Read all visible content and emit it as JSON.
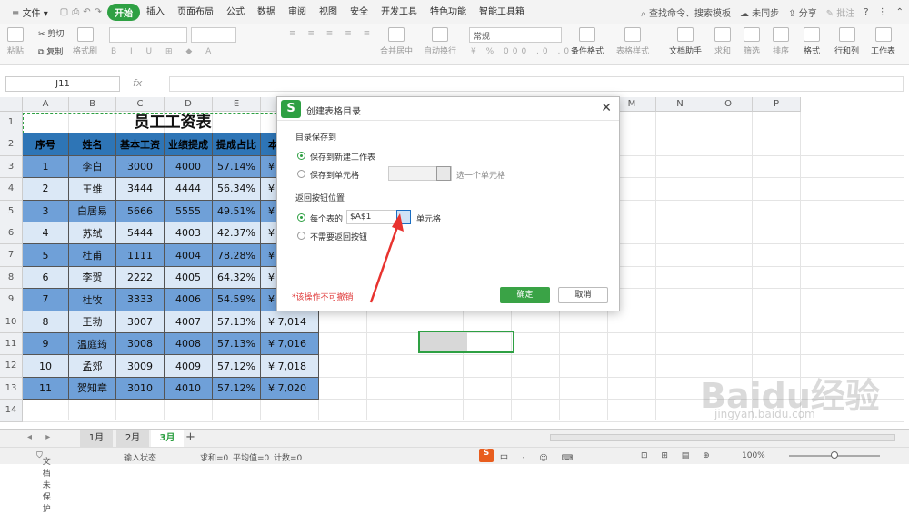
{
  "menu": {
    "file": "文件",
    "items": [
      "开始",
      "插入",
      "页面布局",
      "公式",
      "数据",
      "审阅",
      "视图",
      "安全",
      "开发工具",
      "特色功能",
      "智能工具箱"
    ],
    "active_index": 0,
    "search": "查找命令、搜索模板",
    "sync": "未同步",
    "share": "分享",
    "comment": "批注"
  },
  "ribbon": {
    "paste": "粘贴",
    "cut": "剪切",
    "copy": "复制",
    "format_painter": "格式刷",
    "merge": "合并居中",
    "wrap": "自动换行",
    "number_format": "常规",
    "conditional_format": "条件格式",
    "table_style": "表格样式",
    "doc_helper": "文档助手",
    "sum": "求和",
    "filter": "筛选",
    "sort": "排序",
    "format": "格式",
    "rowcol": "行和列",
    "worksheet": "工作表"
  },
  "formula_bar": {
    "cell_ref": "J11",
    "fx": "fx"
  },
  "columns": [
    "A",
    "B",
    "C",
    "D",
    "E",
    "F",
    "G",
    "H",
    "I",
    "J",
    "K",
    "L",
    "M",
    "N",
    "O",
    "P"
  ],
  "rows": [
    "1",
    "2",
    "3",
    "4",
    "5",
    "6",
    "7",
    "8",
    "9",
    "10",
    "11",
    "12",
    "13",
    "14"
  ],
  "sheet": {
    "title": "员工工资表",
    "headers": [
      "序号",
      "姓名",
      "基本工资",
      "业绩提成",
      "提成占比",
      "本"
    ],
    "data": [
      [
        "1",
        "李白",
        "3000",
        "4000",
        "57.14%",
        "¥"
      ],
      [
        "2",
        "王维",
        "3444",
        "4444",
        "56.34%",
        "¥"
      ],
      [
        "3",
        "白居易",
        "5666",
        "5555",
        "49.51%",
        "¥"
      ],
      [
        "4",
        "苏轼",
        "5444",
        "4003",
        "42.37%",
        "¥"
      ],
      [
        "5",
        "杜甫",
        "1111",
        "4004",
        "78.28%",
        "¥"
      ],
      [
        "6",
        "李贺",
        "2222",
        "4005",
        "64.32%",
        "¥"
      ],
      [
        "7",
        "杜牧",
        "3333",
        "4006",
        "54.59%",
        "¥"
      ],
      [
        "8",
        "王勃",
        "3007",
        "4007",
        "57.13%",
        "¥   7,014"
      ],
      [
        "9",
        "温庭筠",
        "3008",
        "4008",
        "57.13%",
        "¥   7,016"
      ],
      [
        "10",
        "孟郊",
        "3009",
        "4009",
        "57.12%",
        "¥   7,018"
      ],
      [
        "11",
        "贺知章",
        "3010",
        "4010",
        "57.12%",
        "¥   7,020"
      ]
    ]
  },
  "tabs": [
    "1月",
    "2月",
    "3月"
  ],
  "active_tab": "3月",
  "status": {
    "protect": "文档未保护",
    "mode": "输入状态",
    "sum": "求和=0",
    "avg": "平均值=0",
    "count": "计数=0",
    "zoom": "100%"
  },
  "dialog": {
    "title": "创建表格目录",
    "save_to_label": "目录保存到",
    "opt_new_sheet": "保存到新建工作表",
    "opt_cell": "保存到单元格",
    "select_cell_hint": "选一个单元格",
    "return_label": "返回按钮位置",
    "opt_each_sheet": "每个表的",
    "cell_value": "$A$1",
    "cell_suffix": "单元格",
    "opt_no_return": "不需要返回按钮",
    "warning": "*该操作不可撤销",
    "ok": "确定",
    "cancel": "取消"
  },
  "colors": {
    "accent": "#2ea043",
    "header_fill": "#2e75b6",
    "row_dark": "#6fa0d8",
    "row_light": "#dbe8f6",
    "arrow": "#e8332f"
  },
  "watermark": {
    "main": "Baidu经验",
    "sub": "jingyan.baidu.com"
  }
}
